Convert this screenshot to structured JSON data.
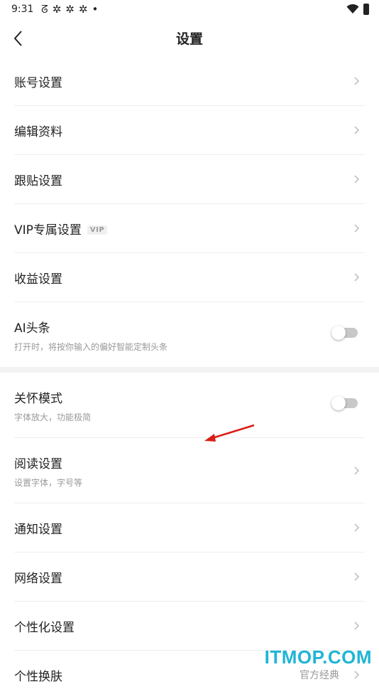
{
  "status_bar": {
    "time": "9:31",
    "icons_left": [
      "notification-icon",
      "app-icon",
      "app-icon",
      "app-icon"
    ],
    "dot": "•"
  },
  "header": {
    "title": "设置"
  },
  "section1": [
    {
      "title": "账号设置"
    },
    {
      "title": "编辑资料"
    },
    {
      "title": "跟贴设置"
    },
    {
      "title": "VIP专属设置",
      "badge": "VIP"
    },
    {
      "title": "收益设置"
    },
    {
      "title": "AI头条",
      "subtitle": "打开时，将按你输入的偏好智能定制头条",
      "toggle": false
    }
  ],
  "section2": [
    {
      "title": "关怀模式",
      "subtitle": "字体放大，功能极简",
      "toggle": false
    },
    {
      "title": "阅读设置",
      "subtitle": "设置字体，字号等"
    },
    {
      "title": "通知设置"
    },
    {
      "title": "网络设置"
    },
    {
      "title": "个性化设置"
    },
    {
      "title": "个性换肤",
      "value": "官方经典"
    }
  ],
  "watermark": "ITMOP.COM",
  "colors": {
    "text": "#222222",
    "subtext": "#999999",
    "divider": "#eeeeee",
    "toggle_off": "#c8c8c8",
    "arrow": "#d91e18",
    "watermark": "#1fb5d6"
  }
}
